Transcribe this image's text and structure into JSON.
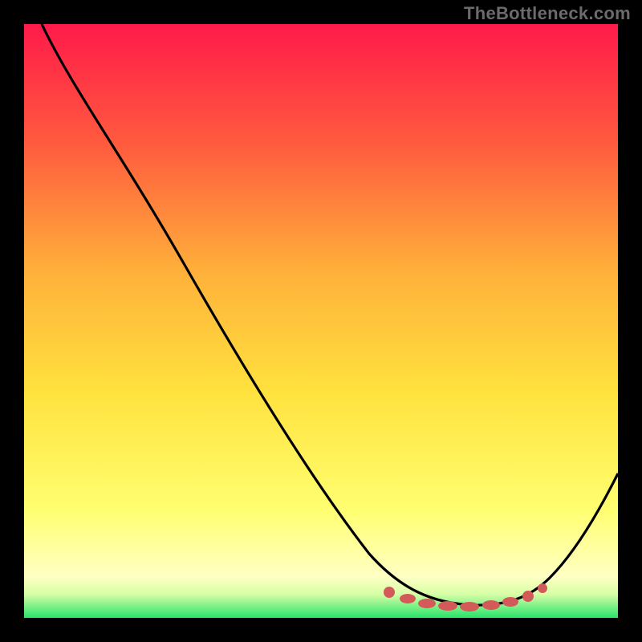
{
  "watermark": "TheBottleneck.com",
  "chart_data": {
    "type": "line",
    "title": "",
    "xlabel": "",
    "ylabel": "",
    "xlim": [
      0,
      100
    ],
    "ylim": [
      0,
      100
    ],
    "grid": false,
    "legend": false,
    "gradient_colors": {
      "top": "#ff1a4a",
      "mid1": "#ff7a33",
      "mid2": "#ffd633",
      "mid3": "#ffff66",
      "bottom_yellow": "#ffffb0",
      "bottom_green": "#2ee86b"
    },
    "series": [
      {
        "name": "bottleneck-curve",
        "color": "#000000",
        "x": [
          3,
          10,
          20,
          30,
          40,
          50,
          57,
          62,
          66,
          70,
          74,
          78,
          82,
          86,
          90,
          94,
          98
        ],
        "y": [
          100,
          90,
          77,
          64,
          51,
          38,
          27,
          18,
          11,
          6,
          3,
          2,
          3,
          7,
          14,
          23,
          33
        ]
      },
      {
        "name": "optimal-zone-dots",
        "color": "#d45a5a",
        "type": "scatter",
        "x": [
          62,
          65,
          68,
          71,
          74,
          77,
          80,
          83,
          85,
          87
        ],
        "y": [
          4,
          3.2,
          2.6,
          2.2,
          2,
          2.1,
          2.4,
          2.9,
          3.5,
          4.3
        ]
      }
    ]
  }
}
